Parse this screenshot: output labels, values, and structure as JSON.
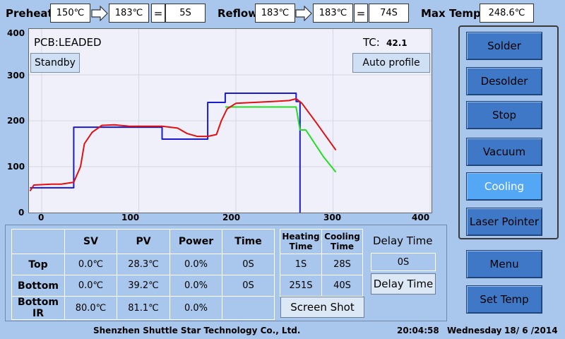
{
  "header": {
    "preheat_label": "Preheat",
    "preheat_start": "150℃",
    "preheat_end": "183℃",
    "preheat_time": "5S",
    "reflow_label": "Reflow",
    "reflow_start": "183℃",
    "reflow_end": "183℃",
    "reflow_time": "74S",
    "max_temp_label": "Max Temp",
    "max_temp_value": "248.6℃",
    "equals": "="
  },
  "chart": {
    "pcb_label": "PCB:LEADED",
    "tc_label": "TC:",
    "tc_value": "42.1",
    "standby_label": "Standby",
    "auto_profile_label": "Auto profile",
    "y_ticks": [
      "400",
      "300",
      "200",
      "100",
      "0"
    ],
    "x_ticks": [
      "0",
      "100",
      "200",
      "300",
      "400"
    ]
  },
  "chart_data": {
    "type": "line",
    "ylim": [
      0,
      400
    ],
    "xlim": [
      -10,
      400
    ],
    "grid": true,
    "series": [
      {
        "color": "#1a1ad0",
        "points": [
          [
            -12,
            54
          ],
          [
            33,
            54
          ],
          [
            33,
            186
          ],
          [
            94,
            186
          ],
          [
            94,
            186
          ],
          [
            124,
            186
          ],
          [
            124,
            160
          ],
          [
            171,
            160
          ],
          [
            171,
            240
          ],
          [
            189,
            240
          ],
          [
            189,
            260
          ],
          [
            262,
            260
          ],
          [
            262,
            242
          ],
          [
            266,
            242
          ],
          [
            266,
            0
          ]
        ]
      },
      {
        "color": "#22dd22",
        "points": [
          [
            189,
            230
          ],
          [
            262,
            230
          ],
          [
            266,
            180
          ],
          [
            272,
            180
          ],
          [
            290,
            122
          ],
          [
            303,
            88
          ]
        ]
      },
      {
        "color": "#e01010",
        "points": [
          [
            -12,
            47
          ],
          [
            -8,
            60
          ],
          [
            10,
            62
          ],
          [
            20,
            62
          ],
          [
            33,
            66
          ],
          [
            40,
            100
          ],
          [
            44,
            150
          ],
          [
            52,
            175
          ],
          [
            62,
            190
          ],
          [
            75,
            191
          ],
          [
            90,
            188
          ],
          [
            110,
            188
          ],
          [
            124,
            188
          ],
          [
            140,
            184
          ],
          [
            150,
            172
          ],
          [
            160,
            166
          ],
          [
            171,
            166
          ],
          [
            180,
            170
          ],
          [
            185,
            200
          ],
          [
            191,
            226
          ],
          [
            200,
            238
          ],
          [
            230,
            241
          ],
          [
            255,
            244
          ],
          [
            262,
            248
          ],
          [
            268,
            238
          ],
          [
            282,
            198
          ],
          [
            303,
            136
          ]
        ]
      }
    ]
  },
  "side_buttons": [
    "Solder",
    "Desolder",
    "Stop",
    "Vacuum",
    "Cooling",
    "Laser Pointer"
  ],
  "lower_buttons": [
    "Menu",
    "Set Temp"
  ],
  "table": {
    "columns": [
      "SV",
      "PV",
      "Power",
      "Time"
    ],
    "rows": [
      {
        "name": "Top",
        "sv": "0.0℃",
        "pv": "28.3℃",
        "power": "0.0%",
        "time": "0S"
      },
      {
        "name": "Bottom",
        "sv": "0.0℃",
        "pv": "39.2℃",
        "power": "0.0%",
        "time": "0S"
      },
      {
        "name": "Bottom IR",
        "sv": "80.0℃",
        "pv": "81.1℃",
        "power": "0.0%",
        "time": ""
      }
    ],
    "heating_label": "Heating Time",
    "cooling_label": "Cooling Time",
    "heating_values": [
      "1S",
      "251S"
    ],
    "cooling_values": [
      "28S",
      "40S"
    ],
    "delay_title": "Delay Time",
    "delay_value": "0S",
    "delay_button": "Delay Time",
    "screenshot_button": "Screen Shot"
  },
  "status_bar": {
    "company": "Shenzhen Shuttle Star Technology Co., Ltd.",
    "time": "20:04:58",
    "day": "Wednesday",
    "date": "18/ 6 /2014"
  }
}
